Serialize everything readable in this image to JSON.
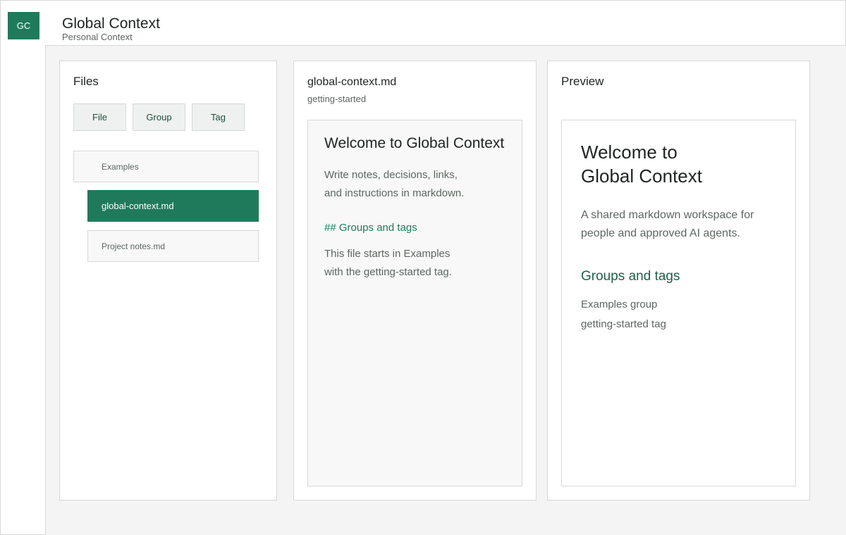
{
  "rail": {
    "logo_text": "GC"
  },
  "header": {
    "title": "Global Context",
    "subtitle": "Personal Context"
  },
  "files_panel": {
    "title": "Files",
    "buttons": [
      {
        "label": "File"
      },
      {
        "label": "Group"
      },
      {
        "label": "Tag"
      }
    ],
    "tree": [
      {
        "label": "Examples",
        "type": "group"
      },
      {
        "label": "global-context.md",
        "type": "file",
        "selected": true
      },
      {
        "label": "Project notes.md",
        "type": "file",
        "selected": false
      }
    ]
  },
  "editor": {
    "filename": "global-context.md",
    "tag": "getting-started",
    "content": {
      "heading": "Welcome to Global Context",
      "para1_line1": "Write notes, decisions, links,",
      "para1_line2": "and instructions in markdown.",
      "heading2": "## Groups and tags",
      "para2_line1": "This file starts in Examples",
      "para2_line2": "with the getting-started tag."
    }
  },
  "preview": {
    "title": "Preview",
    "heading_line1": "Welcome to",
    "heading_line2": "Global Context",
    "para_line1": "A shared markdown workspace for",
    "para_line2": "people and approved AI agents.",
    "heading2": "Groups and tags",
    "group_line": "Examples group",
    "tag_line": "getting-started tag"
  },
  "colors": {
    "accent": "#1f7a5c",
    "accent_dark": "#1f5f48",
    "border": "#d6d9d7",
    "background": "#f3f4f3"
  }
}
